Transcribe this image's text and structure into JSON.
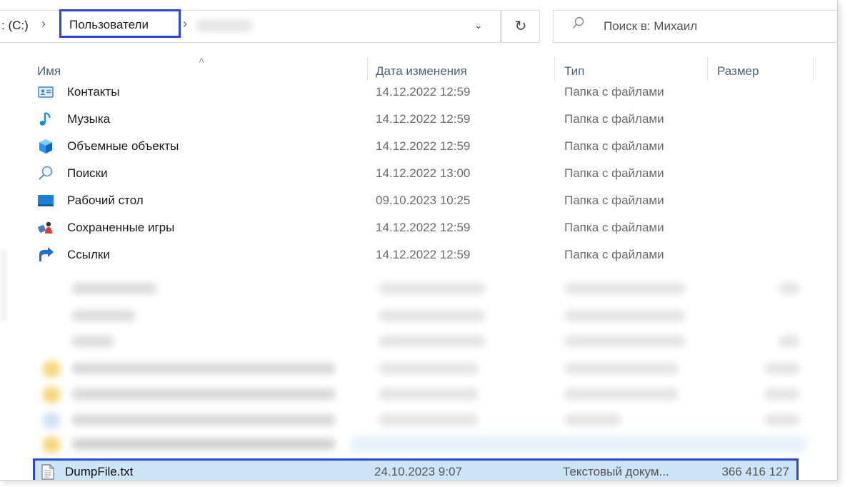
{
  "address_bar": {
    "root": ": (C:)",
    "separator": "›",
    "current_folder": "Пользователи"
  },
  "refresh_icon": "↻",
  "dropdown_icon": "⌄",
  "search": {
    "placeholder": "Поиск в: Михаил"
  },
  "columns": {
    "name": "Имя",
    "date": "Дата изменения",
    "type": "Тип",
    "size": "Размер"
  },
  "sort_caret": "˄",
  "files": [
    {
      "name": "Контакты",
      "date": "14.12.2022 12:59",
      "type": "Папка с файлами",
      "size": "",
      "icon": "contacts-icon"
    },
    {
      "name": "Музыка",
      "date": "14.12.2022 12:59",
      "type": "Папка с файлами",
      "size": "",
      "icon": "music-icon"
    },
    {
      "name": "Объемные объекты",
      "date": "14.12.2022 12:59",
      "type": "Папка с файлами",
      "size": "",
      "icon": "3d-objects-icon"
    },
    {
      "name": "Поиски",
      "date": "14.12.2022 13:00",
      "type": "Папка с файлами",
      "size": "",
      "icon": "searches-icon"
    },
    {
      "name": "Рабочий стол",
      "date": "09.10.2023 10:25",
      "type": "Папка с файлами",
      "size": "",
      "icon": "desktop-icon"
    },
    {
      "name": "Сохраненные игры",
      "date": "14.12.2022 12:59",
      "type": "Папка с файлами",
      "size": "",
      "icon": "saved-games-icon"
    },
    {
      "name": "Ссылки",
      "date": "14.12.2022 12:59",
      "type": "Папка с файлами",
      "size": "",
      "icon": "links-icon"
    }
  ],
  "selected_file": {
    "name": "DumpFile.txt",
    "date": "24.10.2023 9:07",
    "type": "Текстовый докум...",
    "size": "366 416 127",
    "icon": "text-file-icon"
  },
  "colors": {
    "highlight_border": "#2a46d6",
    "selection_bg": "#cce4f7",
    "header_text": "#4a5f7a"
  }
}
